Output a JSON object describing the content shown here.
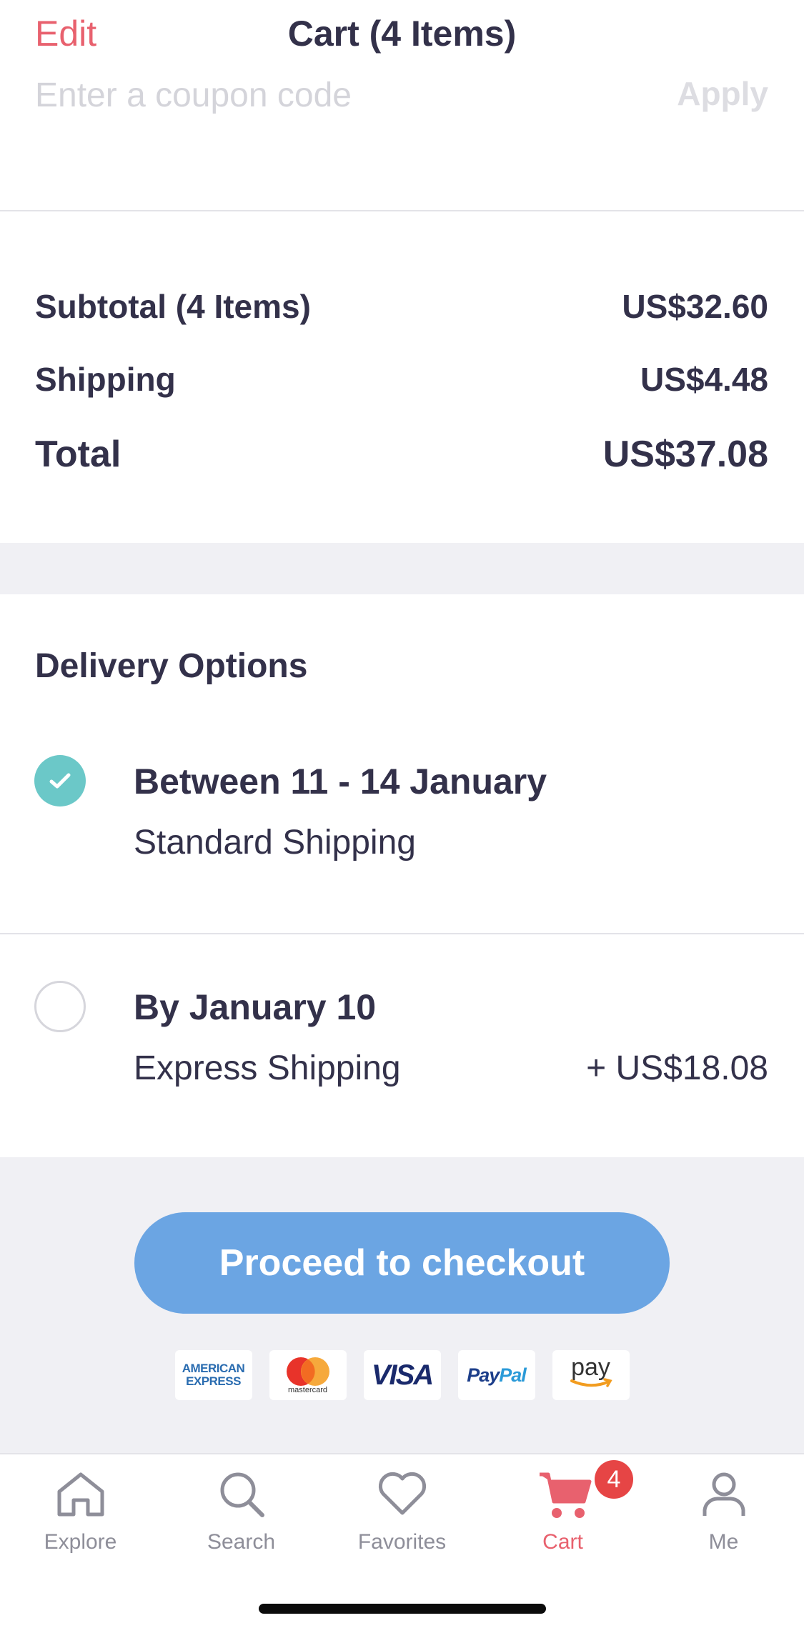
{
  "header": {
    "edit_label": "Edit",
    "title": "Cart (4 Items)"
  },
  "coupon": {
    "placeholder": "Enter a coupon code",
    "apply_label": "Apply"
  },
  "summary": {
    "subtotal_label": "Subtotal (4 Items)",
    "subtotal_value": "US$32.60",
    "shipping_label": "Shipping",
    "shipping_value": "US$4.48",
    "total_label": "Total",
    "total_value": "US$37.08"
  },
  "delivery": {
    "title": "Delivery Options",
    "options": [
      {
        "date": "Between 11 - 14 January",
        "method": "Standard Shipping",
        "price": "",
        "selected": true
      },
      {
        "date": "By January 10",
        "method": "Express Shipping",
        "price": "+ US$18.08",
        "selected": false
      }
    ]
  },
  "checkout": {
    "button_label": "Proceed to checkout",
    "payment_methods": [
      {
        "name": "american-express",
        "text_line1": "AMERICAN",
        "text_line2": "EXPRESS"
      },
      {
        "name": "mastercard",
        "text": "mastercard"
      },
      {
        "name": "visa",
        "text": "VISA"
      },
      {
        "name": "paypal",
        "text_a": "Pay",
        "text_b": "Pal"
      },
      {
        "name": "amazon-pay",
        "text": "pay"
      }
    ]
  },
  "tabbar": {
    "tabs": [
      {
        "label": "Explore",
        "icon": "home-icon"
      },
      {
        "label": "Search",
        "icon": "search-icon"
      },
      {
        "label": "Favorites",
        "icon": "heart-icon"
      },
      {
        "label": "Cart",
        "icon": "cart-icon",
        "active": true
      },
      {
        "label": "Me",
        "icon": "person-icon"
      }
    ],
    "cart_badge": "4"
  },
  "colors": {
    "accent": "#e8616e",
    "teal": "#6bc8c8",
    "button_blue": "#6ba5e3",
    "badge_red": "#e64545"
  }
}
